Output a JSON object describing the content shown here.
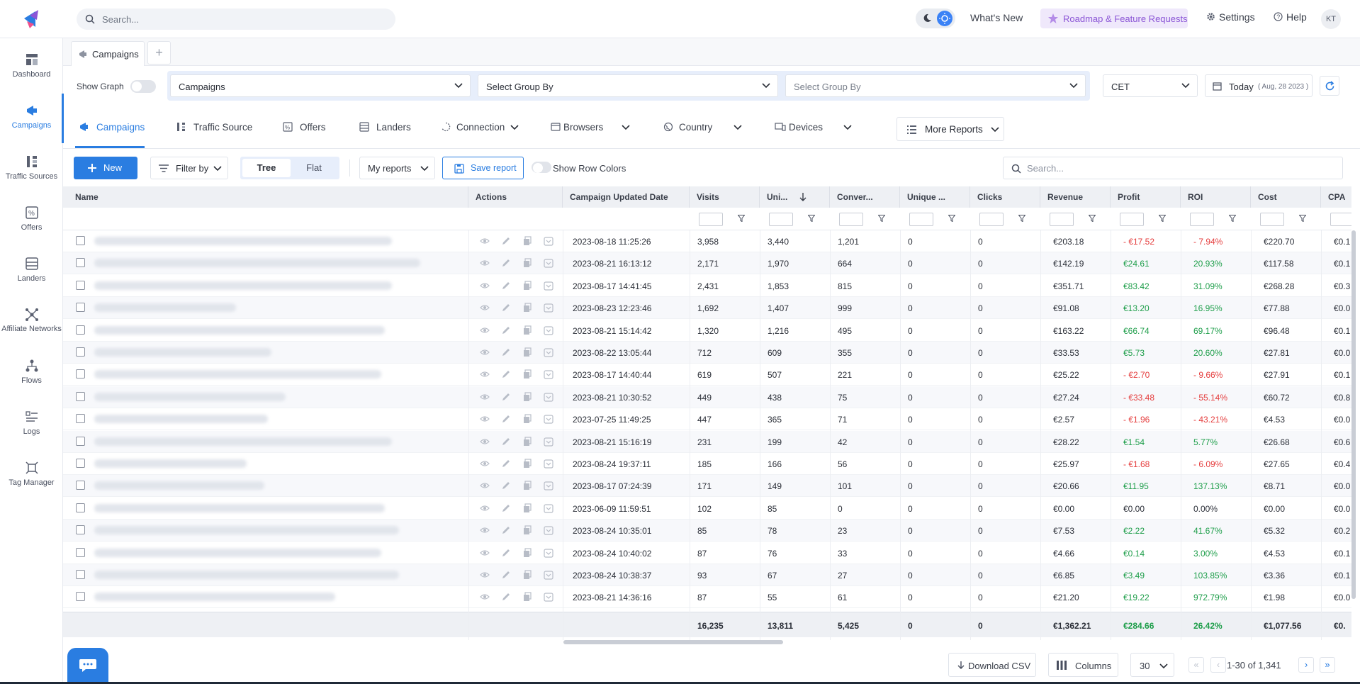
{
  "topbar": {
    "search_placeholder": "Search...",
    "whats_new": "What's New",
    "roadmap": "Roadmap & Feature Requests",
    "settings": "Settings",
    "help": "Help",
    "avatar": "KT"
  },
  "sidebar": {
    "items": [
      {
        "label": "Dashboard",
        "icon": "dashboard-icon"
      },
      {
        "label": "Campaigns",
        "icon": "megaphone-icon",
        "active": true
      },
      {
        "label": "Traffic Sources",
        "icon": "traffic-sources-icon"
      },
      {
        "label": "Offers",
        "icon": "offers-icon"
      },
      {
        "label": "Landers",
        "icon": "landers-icon"
      },
      {
        "label": "Affiliate Networks",
        "icon": "network-icon"
      },
      {
        "label": "Flows",
        "icon": "flows-icon"
      },
      {
        "label": "Logs",
        "icon": "logs-icon"
      },
      {
        "label": "Tag Manager",
        "icon": "tag-manager-icon"
      }
    ]
  },
  "tabs": {
    "file_tab": "Campaigns",
    "add": "+"
  },
  "filters": {
    "show_graph": "Show Graph",
    "group1": "Campaigns",
    "group2": "Select Group By",
    "group3": "Select Group By",
    "timezone": "CET",
    "date_label": "Today",
    "date_detail": "( Aug, 28 2023 )"
  },
  "report_tabs": {
    "campaigns": "Campaigns",
    "traffic_source": "Traffic Source",
    "offers": "Offers",
    "landers": "Landers",
    "connection": "Connection",
    "browsers": "Browsers",
    "country": "Country",
    "devices": "Devices",
    "more": "More Reports"
  },
  "toolbar": {
    "new": "New",
    "filter_by": "Filter by",
    "tree": "Tree",
    "flat": "Flat",
    "my_reports": "My reports",
    "save_report": "Save report",
    "show_row_colors": "Show Row Colors",
    "search_placeholder": "Search..."
  },
  "table": {
    "headers": {
      "name": "Name",
      "actions": "Actions",
      "updated": "Campaign Updated Date",
      "visits": "Visits",
      "uniques": "Uni...",
      "conversions": "Conver...",
      "unique_clicks": "Unique ...",
      "clicks": "Clicks",
      "revenue": "Revenue",
      "profit": "Profit",
      "roi": "ROI",
      "cost": "Cost",
      "cpa": "CPA"
    },
    "rows": [
      {
        "date": "2023-08-18 11:25:26",
        "visits": "3,958",
        "uniques": "3,440",
        "conv": "1,201",
        "uc": "0",
        "clicks": "0",
        "revenue": "€203.18",
        "profit": "- €17.52",
        "roi": "- 7.94%",
        "cost": "€220.70",
        "cpa": "€0.1",
        "sign": "neg"
      },
      {
        "date": "2023-08-21 16:13:12",
        "visits": "2,171",
        "uniques": "1,970",
        "conv": "664",
        "uc": "0",
        "clicks": "0",
        "revenue": "€142.19",
        "profit": "€24.61",
        "roi": "20.93%",
        "cost": "€117.58",
        "cpa": "€0.1",
        "sign": "pos"
      },
      {
        "date": "2023-08-17 14:41:45",
        "visits": "2,431",
        "uniques": "1,853",
        "conv": "815",
        "uc": "0",
        "clicks": "0",
        "revenue": "€351.71",
        "profit": "€83.42",
        "roi": "31.09%",
        "cost": "€268.28",
        "cpa": "€0.3",
        "sign": "pos"
      },
      {
        "date": "2023-08-23 12:23:46",
        "visits": "1,692",
        "uniques": "1,407",
        "conv": "999",
        "uc": "0",
        "clicks": "0",
        "revenue": "€91.08",
        "profit": "€13.20",
        "roi": "16.95%",
        "cost": "€77.88",
        "cpa": "€0.0",
        "sign": "pos"
      },
      {
        "date": "2023-08-21 15:14:42",
        "visits": "1,320",
        "uniques": "1,216",
        "conv": "495",
        "uc": "0",
        "clicks": "0",
        "revenue": "€163.22",
        "profit": "€66.74",
        "roi": "69.17%",
        "cost": "€96.48",
        "cpa": "€0.1",
        "sign": "pos"
      },
      {
        "date": "2023-08-22 13:05:44",
        "visits": "712",
        "uniques": "609",
        "conv": "355",
        "uc": "0",
        "clicks": "0",
        "revenue": "€33.53",
        "profit": "€5.73",
        "roi": "20.60%",
        "cost": "€27.81",
        "cpa": "€0.0",
        "sign": "pos"
      },
      {
        "date": "2023-08-17 14:40:44",
        "visits": "619",
        "uniques": "507",
        "conv": "221",
        "uc": "0",
        "clicks": "0",
        "revenue": "€25.22",
        "profit": "- €2.70",
        "roi": "- 9.66%",
        "cost": "€27.91",
        "cpa": "€0.1",
        "sign": "neg"
      },
      {
        "date": "2023-08-21 10:30:52",
        "visits": "449",
        "uniques": "438",
        "conv": "75",
        "uc": "0",
        "clicks": "0",
        "revenue": "€27.24",
        "profit": "- €33.48",
        "roi": "- 55.14%",
        "cost": "€60.72",
        "cpa": "€0.8",
        "sign": "neg"
      },
      {
        "date": "2023-07-25 11:49:25",
        "visits": "447",
        "uniques": "365",
        "conv": "71",
        "uc": "0",
        "clicks": "0",
        "revenue": "€2.57",
        "profit": "- €1.96",
        "roi": "- 43.21%",
        "cost": "€4.53",
        "cpa": "€0.0",
        "sign": "neg"
      },
      {
        "date": "2023-08-21 15:16:19",
        "visits": "231",
        "uniques": "199",
        "conv": "42",
        "uc": "0",
        "clicks": "0",
        "revenue": "€28.22",
        "profit": "€1.54",
        "roi": "5.77%",
        "cost": "€26.68",
        "cpa": "€0.6",
        "sign": "pos"
      },
      {
        "date": "2023-08-24 19:37:11",
        "visits": "185",
        "uniques": "166",
        "conv": "56",
        "uc": "0",
        "clicks": "0",
        "revenue": "€25.97",
        "profit": "- €1.68",
        "roi": "- 6.09%",
        "cost": "€27.65",
        "cpa": "€0.4",
        "sign": "neg"
      },
      {
        "date": "2023-08-17 07:24:39",
        "visits": "171",
        "uniques": "149",
        "conv": "101",
        "uc": "0",
        "clicks": "0",
        "revenue": "€20.66",
        "profit": "€11.95",
        "roi": "137.13%",
        "cost": "€8.71",
        "cpa": "€0.0",
        "sign": "pos"
      },
      {
        "date": "2023-06-09 11:59:51",
        "visits": "102",
        "uniques": "85",
        "conv": "0",
        "uc": "0",
        "clicks": "0",
        "revenue": "€0.00",
        "profit": "€0.00",
        "roi": "0.00%",
        "cost": "€0.00",
        "cpa": "€0.0",
        "sign": "zero"
      },
      {
        "date": "2023-08-24 10:35:01",
        "visits": "85",
        "uniques": "78",
        "conv": "23",
        "uc": "0",
        "clicks": "0",
        "revenue": "€7.53",
        "profit": "€2.22",
        "roi": "41.67%",
        "cost": "€5.32",
        "cpa": "€0.2",
        "sign": "pos"
      },
      {
        "date": "2023-08-24 10:40:02",
        "visits": "87",
        "uniques": "76",
        "conv": "33",
        "uc": "0",
        "clicks": "0",
        "revenue": "€4.66",
        "profit": "€0.14",
        "roi": "3.00%",
        "cost": "€4.53",
        "cpa": "€0.1",
        "sign": "pos"
      },
      {
        "date": "2023-08-24 10:38:37",
        "visits": "93",
        "uniques": "67",
        "conv": "27",
        "uc": "0",
        "clicks": "0",
        "revenue": "€6.85",
        "profit": "€3.49",
        "roi": "103.85%",
        "cost": "€3.36",
        "cpa": "€0.1",
        "sign": "pos"
      },
      {
        "date": "2023-08-21 14:36:16",
        "visits": "87",
        "uniques": "55",
        "conv": "61",
        "uc": "0",
        "clicks": "0",
        "revenue": "€21.20",
        "profit": "€19.22",
        "roi": "972.79%",
        "cost": "€1.98",
        "cpa": "€0.0",
        "sign": "pos"
      }
    ],
    "totals": {
      "visits": "16,235",
      "uniques": "13,811",
      "conv": "5,425",
      "uc": "0",
      "clicks": "0",
      "revenue": "€1,362.21",
      "profit": "€284.66",
      "roi": "26.42%",
      "cost": "€1,077.56",
      "cpa": "€0."
    }
  },
  "footer": {
    "download": "Download CSV",
    "columns": "Columns",
    "per_page": "30",
    "range": "1-30 of 1,341"
  },
  "colors": {
    "accent": "#2a7de1",
    "negative": "#e53e3e",
    "positive": "#1e9e4a",
    "roadmap": "#8b55d6"
  }
}
